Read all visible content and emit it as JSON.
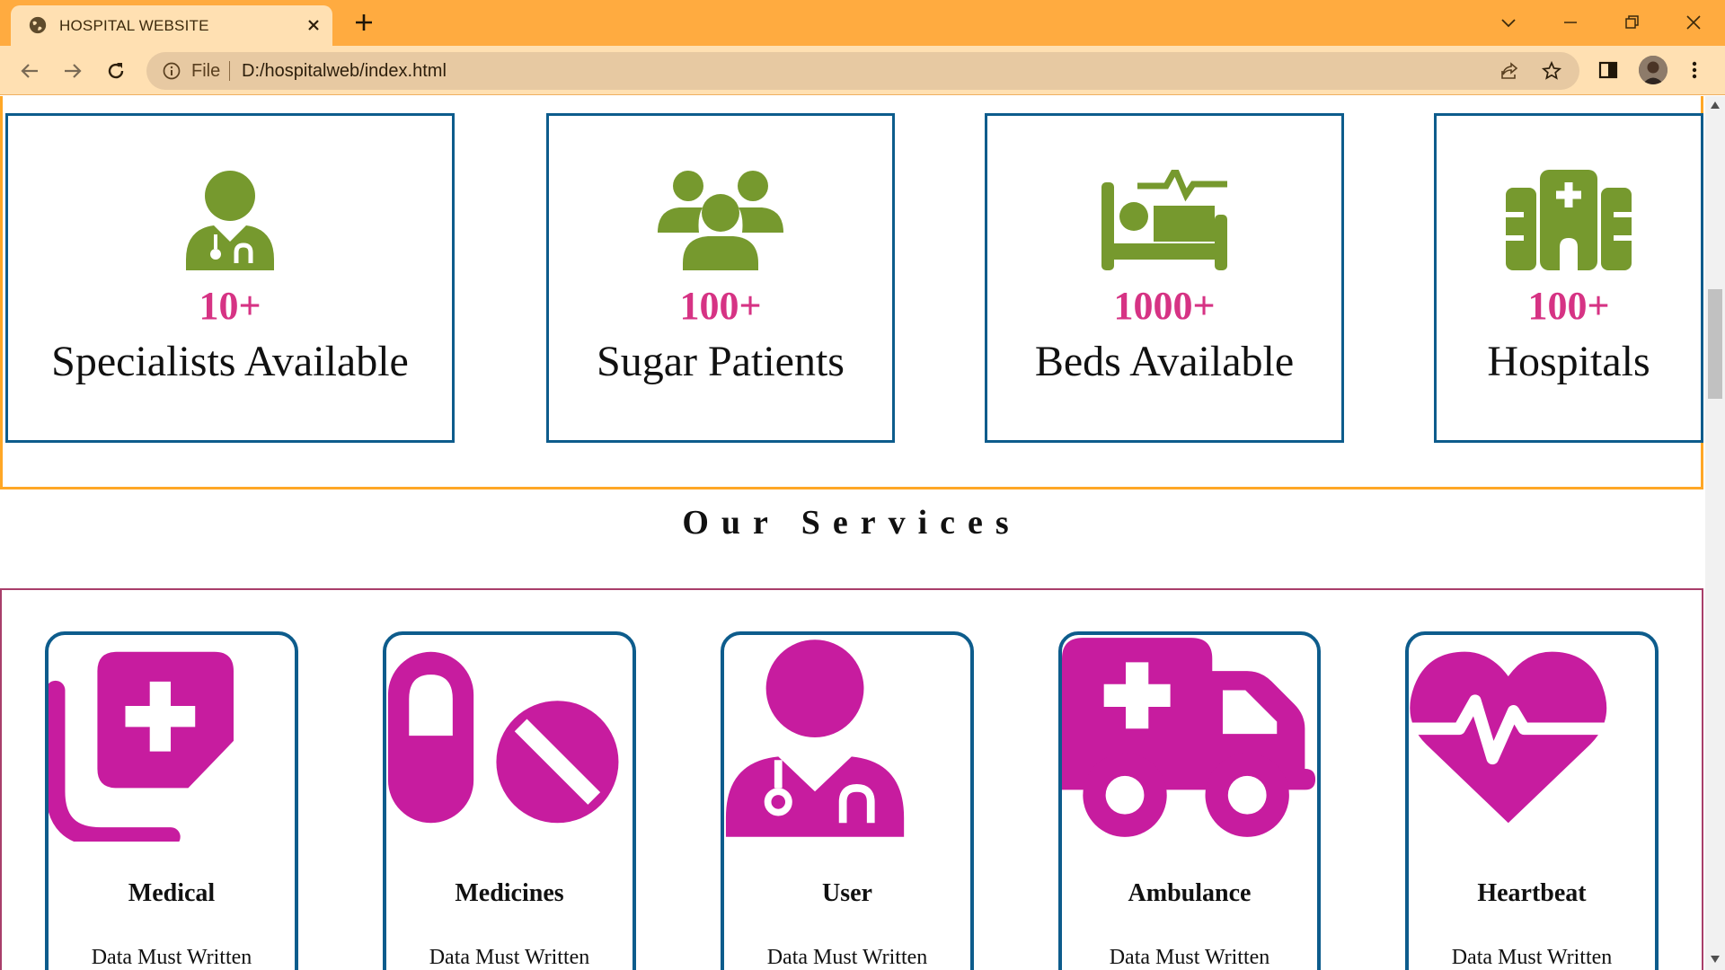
{
  "browser": {
    "tab_title": "HOSPITAL WEBSITE",
    "address_scheme": "File",
    "address_url": "D:/hospitalweb/index.html",
    "accent_color": "#ffab40",
    "toolbar_color": "#ffe0b2"
  },
  "stats": [
    {
      "number": "10+",
      "label": "Specialists Available",
      "icon": "doctor-icon"
    },
    {
      "number": "100+",
      "label": "Sugar Patients",
      "icon": "users-icon"
    },
    {
      "number": "1000+",
      "label": "Beds Available",
      "icon": "bed-pulse-icon"
    },
    {
      "number": "100+",
      "label": "Hospitals",
      "icon": "hospital-icon"
    }
  ],
  "services_heading": "Our Services",
  "services": [
    {
      "title": "Medical",
      "desc": "Data Must Written",
      "icon": "medical-notes-icon"
    },
    {
      "title": "Medicines",
      "desc": "Data Must Written",
      "icon": "pills-icon"
    },
    {
      "title": "User",
      "desc": "Data Must Written",
      "icon": "user-doctor-icon"
    },
    {
      "title": "Ambulance",
      "desc": "Data Must Written",
      "icon": "ambulance-icon"
    },
    {
      "title": "Heartbeat",
      "desc": "Data Must Written",
      "icon": "heart-pulse-icon"
    }
  ],
  "colors": {
    "stat_icon": "#76992e",
    "stat_number": "#d63384",
    "service_icon": "#c71c9f",
    "card_border": "#0d5c8c",
    "stats_section_border": "#ffa726",
    "services_section_border": "#a83e6a"
  }
}
